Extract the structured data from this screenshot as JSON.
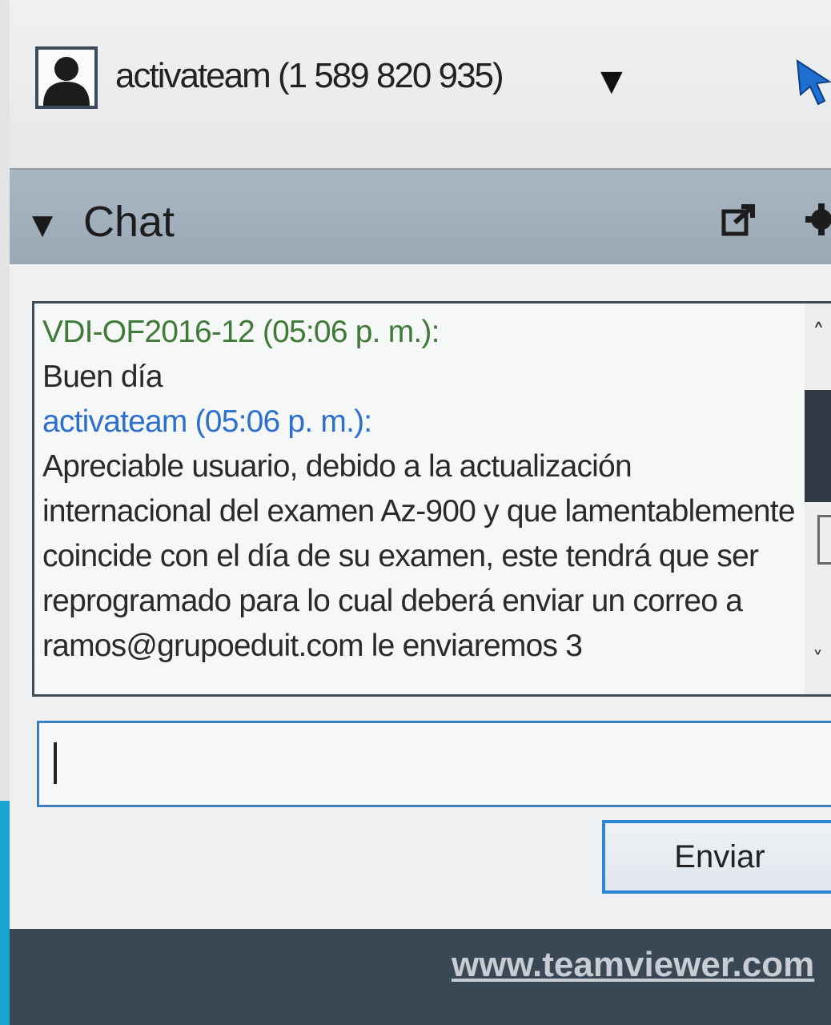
{
  "account": {
    "name": "activateam (1 589 820 935)"
  },
  "chat": {
    "title": "Chat",
    "messages": [
      {
        "sender": "VDI-OF2016-12 (05:06 p. m.):",
        "text": "Buen día"
      },
      {
        "sender": "activateam (05:06 p. m.):",
        "text": "Apreciable usuario, debido a la actualización internacional del examen Az-900 y que lamentablemente coincide con el día de su examen, este tendrá que ser reprogramado para lo cual deberá enviar un correo a ramos@grupoeduit.com le enviaremos 3"
      }
    ],
    "input_value": "",
    "send_label": "Enviar"
  },
  "footer": {
    "link": "www.teamviewer.com"
  },
  "colors": {
    "local_sender": "#3f7a38",
    "remote_sender": "#2c6fd1",
    "accent": "#2f86d6",
    "footer_bg": "#3a4856"
  }
}
